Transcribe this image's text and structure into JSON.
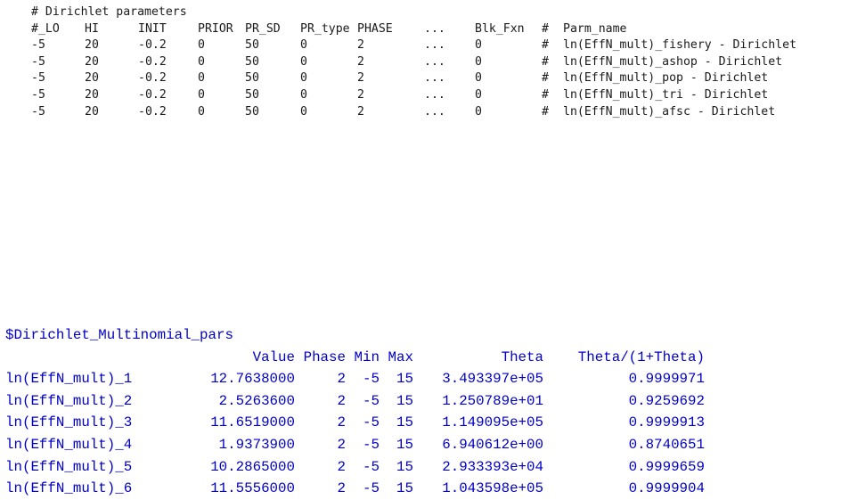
{
  "ctl": {
    "comment": "# Dirichlet parameters",
    "headers": [
      "#_LO",
      "HI",
      "INIT",
      "PRIOR",
      "PR_SD",
      "PR_type",
      "PHASE",
      "...",
      "Blk_Fxn",
      "#",
      "Parm_name"
    ],
    "rows": [
      [
        "-5",
        "20",
        "-0.2",
        "0",
        "50",
        "0",
        "2",
        "...",
        "0",
        "#",
        "ln(EffN_mult)_fishery - Dirichlet"
      ],
      [
        "-5",
        "20",
        "-0.2",
        "0",
        "50",
        "0",
        "2",
        "...",
        "0",
        "#",
        "ln(EffN_mult)_ashop - Dirichlet"
      ],
      [
        "-5",
        "20",
        "-0.2",
        "0",
        "50",
        "0",
        "2",
        "...",
        "0",
        "#",
        "ln(EffN_mult)_pop - Dirichlet"
      ],
      [
        "-5",
        "20",
        "-0.2",
        "0",
        "50",
        "0",
        "2",
        "...",
        "0",
        "#",
        "ln(EffN_mult)_tri - Dirichlet"
      ],
      [
        "-5",
        "20",
        "-0.2",
        "0",
        "50",
        "0",
        "2",
        "...",
        "0",
        "#",
        "ln(EffN_mult)_afsc - Dirichlet"
      ]
    ]
  },
  "r_output": {
    "title": "$Dirichlet_Multinomial_pars",
    "headers": [
      "",
      "Value",
      "Phase",
      "Min",
      "Max",
      "Theta",
      "Theta/(1+Theta)"
    ],
    "rows": [
      [
        "ln(EffN_mult)_1",
        "12.7638000",
        "2",
        "-5",
        "15",
        "3.493397e+05",
        "0.9999971"
      ],
      [
        "ln(EffN_mult)_2",
        "2.5263600",
        "2",
        "-5",
        "15",
        "1.250789e+01",
        "0.9259692"
      ],
      [
        "ln(EffN_mult)_3",
        "11.6519000",
        "2",
        "-5",
        "15",
        "1.149095e+05",
        "0.9999913"
      ],
      [
        "ln(EffN_mult)_4",
        "1.9373900",
        "2",
        "-5",
        "15",
        "6.940612e+00",
        "0.8740651"
      ],
      [
        "ln(EffN_mult)_5",
        "10.2865000",
        "2",
        "-5",
        "15",
        "2.933393e+04",
        "0.9999659"
      ],
      [
        "ln(EffN_mult)_6",
        "11.5556000",
        "2",
        "-5",
        "15",
        "1.043598e+05",
        "0.9999904"
      ]
    ]
  }
}
